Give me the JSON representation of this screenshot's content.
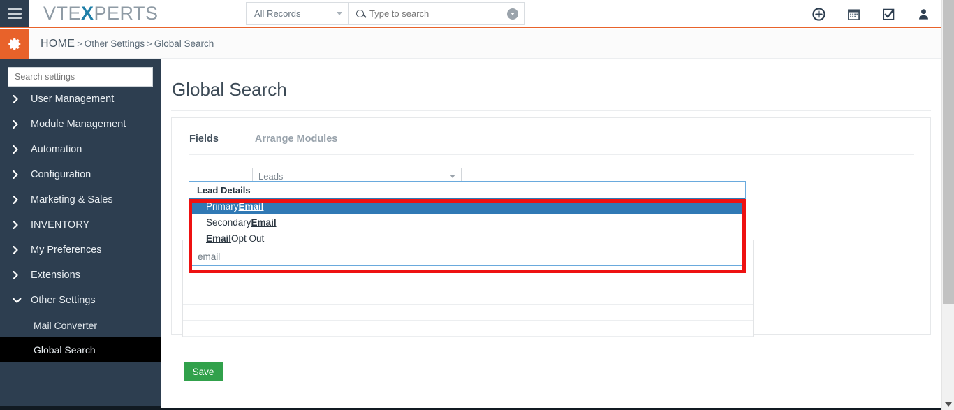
{
  "brand": {
    "prefix": "VTE",
    "x": "X",
    "suffix": "PERTS"
  },
  "topbar": {
    "records_select": {
      "value": "All Records",
      "icon": "chevron-down-icon"
    },
    "search": {
      "value": "",
      "placeholder": "Type to search",
      "icon": "search-icon",
      "dropdown_icon": "chevron-down-circle-icon"
    },
    "icons": [
      "plus-circle-icon",
      "calendar-icon",
      "checkbox-checked-icon",
      "user-icon"
    ],
    "menu_icon": "hamburger-menu-icon",
    "accent_color": "#e8622a"
  },
  "breadcrumb": {
    "settings_icon": "gear-icon",
    "home": "HOME",
    "sep1": ">",
    "segment1": "Other Settings",
    "sep2": ">",
    "segment2": "Global Search"
  },
  "sidebar": {
    "search": {
      "value": "",
      "placeholder": "Search settings"
    },
    "items": [
      {
        "label": "User Management",
        "state": "collapsed"
      },
      {
        "label": "Module Management",
        "state": "collapsed"
      },
      {
        "label": "Automation",
        "state": "collapsed"
      },
      {
        "label": "Configuration",
        "state": "collapsed"
      },
      {
        "label": "Marketing & Sales",
        "state": "collapsed"
      },
      {
        "label": "INVENTORY",
        "state": "collapsed"
      },
      {
        "label": "My Preferences",
        "state": "collapsed"
      },
      {
        "label": "Extensions",
        "state": "collapsed"
      },
      {
        "label": "Other Settings",
        "state": "expanded"
      }
    ],
    "sub_items": [
      {
        "label": "Mail Converter",
        "active": false
      },
      {
        "label": "Global Search",
        "active": true
      }
    ],
    "bg_color": "#2d3e50",
    "active_bg_color": "#000000"
  },
  "main": {
    "page_title": "Global Search",
    "tabs": [
      {
        "label": "Fields",
        "active": true
      },
      {
        "label": "Arrange Modules",
        "active": false
      }
    ],
    "module_select": {
      "value": "Leads",
      "icon": "chevron-down-icon"
    },
    "save_button": {
      "label": "Save",
      "color": "#31a14b"
    }
  },
  "dropdown": {
    "group_label": "Lead Details",
    "options": [
      {
        "pre": "Primary ",
        "highlight": "Email",
        "post": "",
        "selected": true
      },
      {
        "pre": "Secondary ",
        "highlight": "Email",
        "post": "",
        "selected": false
      },
      {
        "pre": "",
        "highlight": "Email",
        "post": " Opt Out",
        "selected": false
      }
    ],
    "filter_input": {
      "value": "email",
      "placeholder": ""
    },
    "selected_color": "#3079b5",
    "border_color": "#6aaadd"
  },
  "annotation": {
    "shape": "rectangle",
    "color": "#ee1111"
  },
  "scrollbar": {
    "orientation": "vertical",
    "thumb_color": "#c2c2c2"
  }
}
